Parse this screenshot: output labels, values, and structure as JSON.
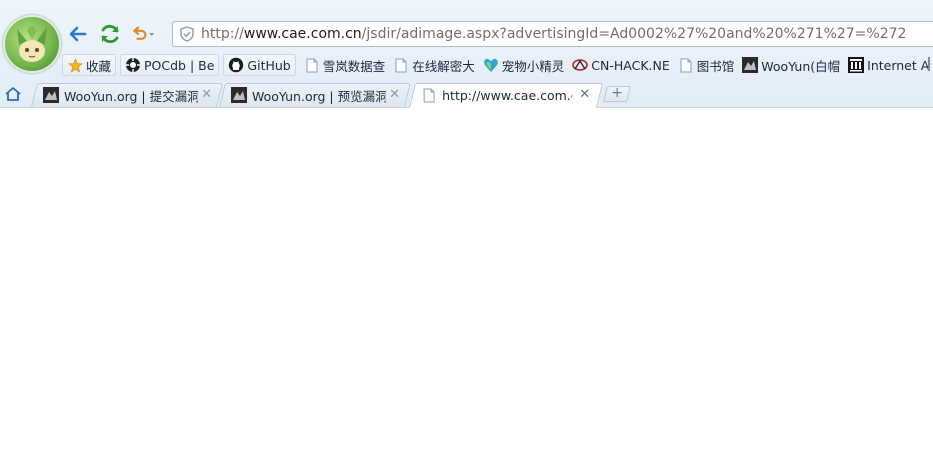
{
  "toolbar": {
    "url_prefix": "http://",
    "url_domain": "www.cae.com.cn",
    "url_path": "/jsdir/adimage.aspx?advertisingId=Ad0002%27%20and%20%271%27=%272"
  },
  "bookmarks": [
    {
      "label": "收藏",
      "icon": "star-icon"
    },
    {
      "label": "POCdb | Be",
      "icon": "pocdb-icon"
    },
    {
      "label": "GitHub",
      "icon": "github-icon"
    },
    {
      "label": "雪岚数据查",
      "icon": "page-icon"
    },
    {
      "label": "在线解密大",
      "icon": "page-icon"
    },
    {
      "label": "宠物小精灵",
      "icon": "pet-icon"
    },
    {
      "label": "CN-HACK.NE",
      "icon": "cnhack-icon"
    },
    {
      "label": "图书馆",
      "icon": "page-icon"
    },
    {
      "label": "WooYun(白帽",
      "icon": "wooyun-icon"
    },
    {
      "label": "Internet A",
      "icon": "archive-icon"
    }
  ],
  "tabs": [
    {
      "title": "WooYun.org | 提交漏洞",
      "active": false
    },
    {
      "title": "WooYun.org | 预览漏洞",
      "active": false
    },
    {
      "title": "http://www.cae.com.cn",
      "active": true
    }
  ],
  "colors": {
    "accent_green": "#2e9b2e",
    "back_blue": "#2b7bd0",
    "undo_orange": "#e08a1e"
  }
}
